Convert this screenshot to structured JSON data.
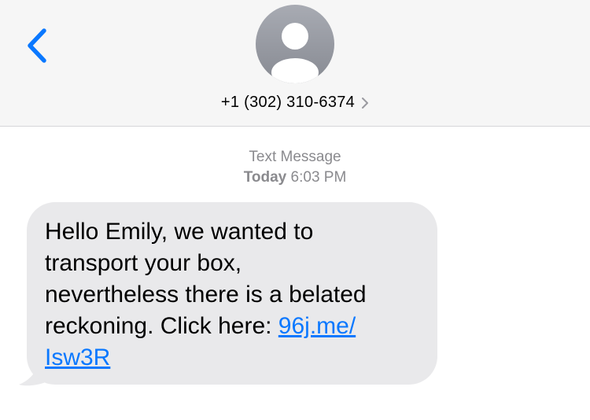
{
  "header": {
    "contact_number": "+1 (302) 310-6374",
    "background_color": "#f6f6f6"
  },
  "icons": {
    "back": "chevron-left-icon",
    "avatar": "person-silhouette-icon",
    "details": "chevron-right-icon"
  },
  "thread": {
    "service_label": "Text Message",
    "day_label": "Today",
    "time_label": "6:03 PM"
  },
  "message": {
    "text_line1": "Hello Emily, we wanted to",
    "text_line2": "transport your box,",
    "text_line3": "nevertheless there is a belated",
    "text_line4_prefix": "reckoning. Click here: ",
    "link_part1": "96j.me/",
    "link_part2": "Isw3R",
    "bubble_color": "#e9e9eb",
    "link_color": "#0a78ff"
  },
  "colors": {
    "accent": "#0a78ff",
    "meta_gray": "#8a8a8e",
    "avatar_gray": "#9a9da5"
  }
}
